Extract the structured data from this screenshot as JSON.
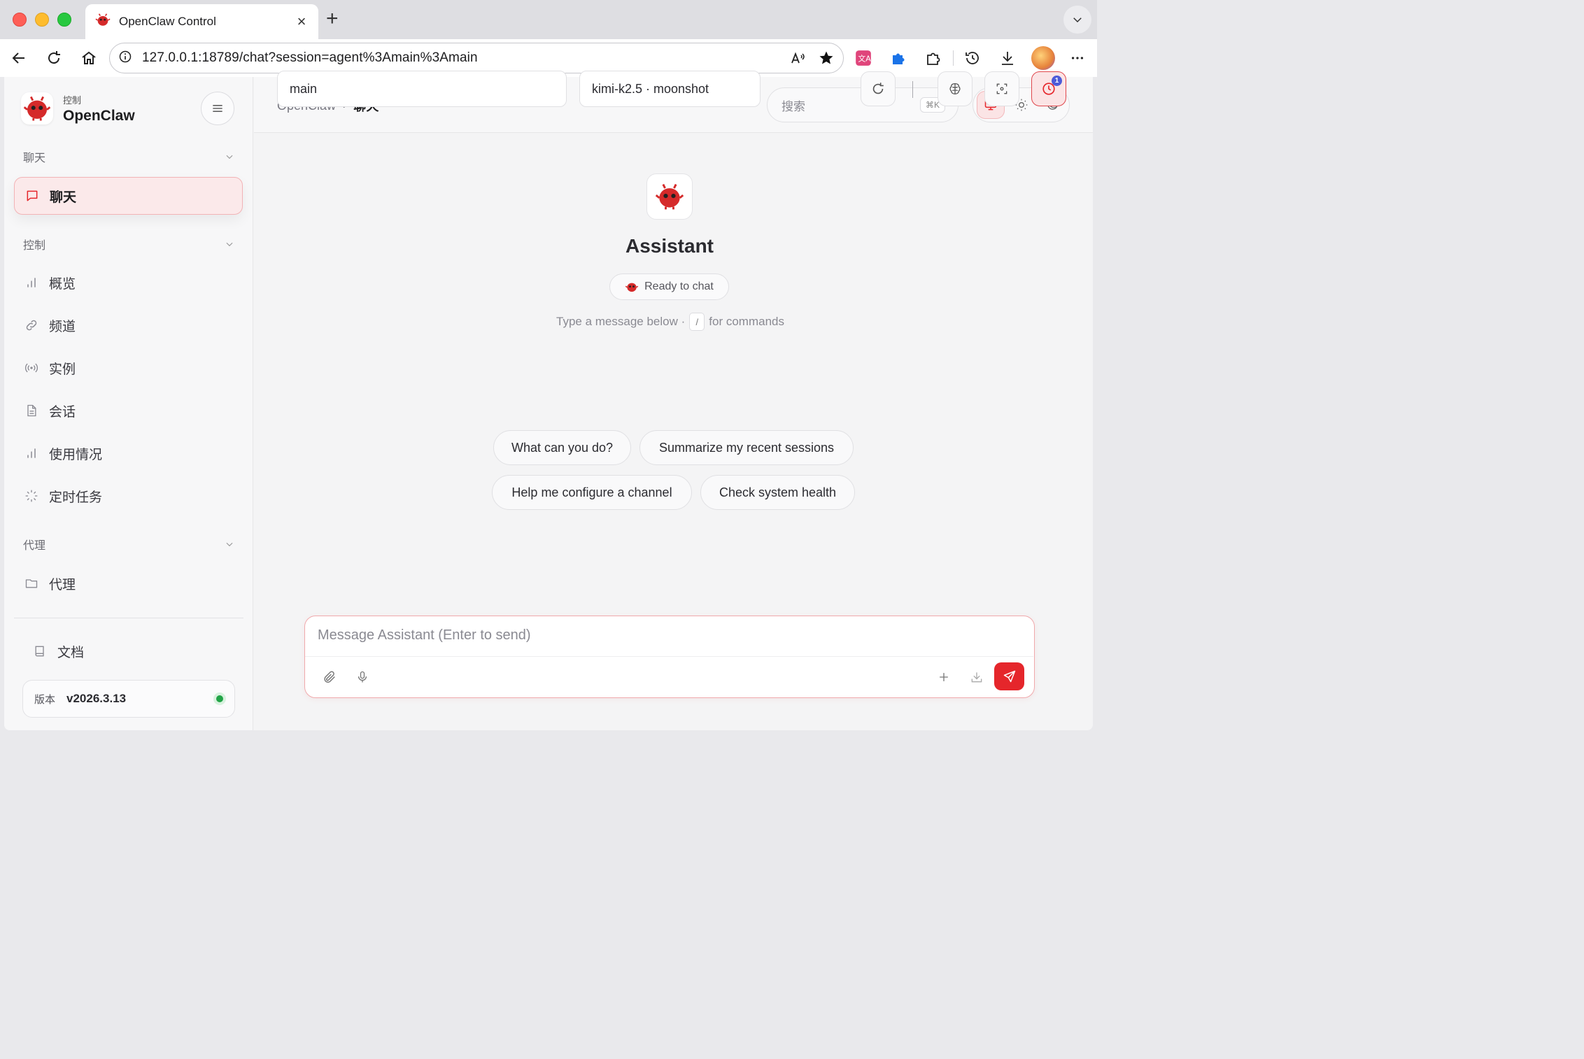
{
  "browser": {
    "tab_title": "OpenClaw Control",
    "url": "127.0.0.1:18789/chat?session=agent%3Amain%3Amain"
  },
  "sidebar": {
    "brand_sub": "控制",
    "brand_name": "OpenClaw",
    "groups": [
      {
        "label": "聊天",
        "items": [
          {
            "label": "聊天",
            "icon": "chat-icon",
            "active": true
          }
        ]
      },
      {
        "label": "控制",
        "items": [
          {
            "label": "概览",
            "icon": "bar-chart-icon"
          },
          {
            "label": "频道",
            "icon": "link-icon"
          },
          {
            "label": "实例",
            "icon": "broadcast-icon"
          },
          {
            "label": "会话",
            "icon": "document-icon"
          },
          {
            "label": "使用情况",
            "icon": "bar-chart-icon"
          },
          {
            "label": "定时任务",
            "icon": "loader-icon"
          }
        ]
      },
      {
        "label": "代理",
        "items": [
          {
            "label": "代理",
            "icon": "folder-icon"
          }
        ]
      }
    ],
    "docs_label": "文档",
    "version_label": "版本",
    "version_value": "v2026.3.13"
  },
  "topbar": {
    "breadcrumb_root": "OpenClaw",
    "breadcrumb_sep": "›",
    "breadcrumb_current": "聊天",
    "search_placeholder": "搜索",
    "search_shortcut": "⌘K"
  },
  "chat": {
    "session": "main",
    "model": "kimi-k2.5 · moonshot",
    "cron_badge": "1",
    "assistant_name": "Assistant",
    "status": "Ready to chat",
    "hint_prefix": "Type a message below ·",
    "hint_key": "/",
    "hint_suffix": "for commands",
    "suggestions": [
      "What can you do?",
      "Summarize my recent sessions",
      "Help me configure a channel",
      "Check system health"
    ],
    "composer_placeholder": "Message Assistant (Enter to send)"
  },
  "colors": {
    "accent": "#e5262b",
    "accent_soft": "#fbe9ea",
    "status_online": "#22a447"
  }
}
